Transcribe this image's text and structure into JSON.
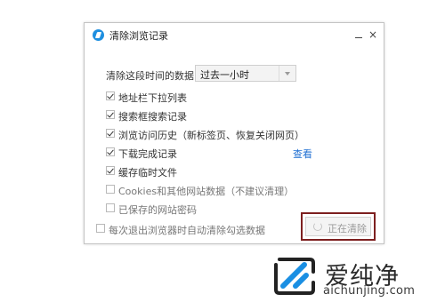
{
  "dialog": {
    "title": "清除浏览记录",
    "minimize_glyph": "",
    "close_glyph": "×"
  },
  "range": {
    "label": "清除这段时间的数据：",
    "selected": "过去一小时"
  },
  "options": [
    {
      "label": "地址栏下拉列表",
      "checked": true
    },
    {
      "label": "搜索框搜索记录",
      "checked": true
    },
    {
      "label": "浏览访问历史（新标签页、恢复关闭网页）",
      "checked": true
    },
    {
      "label": "下载完成记录",
      "checked": true
    },
    {
      "label": "缓存临时文件",
      "checked": true
    },
    {
      "label": "Cookies和其他网站数据（不建议清理）",
      "checked": false
    },
    {
      "label": "已保存的网站密码",
      "checked": false
    }
  ],
  "view_link": "查看",
  "auto_clear": {
    "label": "每次退出浏览器时自动清除勾选数据",
    "checked": false
  },
  "clearing_button": {
    "label": "正在清除",
    "icon": "spinner-icon"
  },
  "watermark": {
    "name": "爱纯净",
    "domain": "aichunjing.com"
  },
  "colors": {
    "link": "#1f6fd2",
    "highlight_border": "#7d1f1f",
    "app_icon": "#1e8fe0",
    "logo_blue": "#1a8fe3"
  }
}
